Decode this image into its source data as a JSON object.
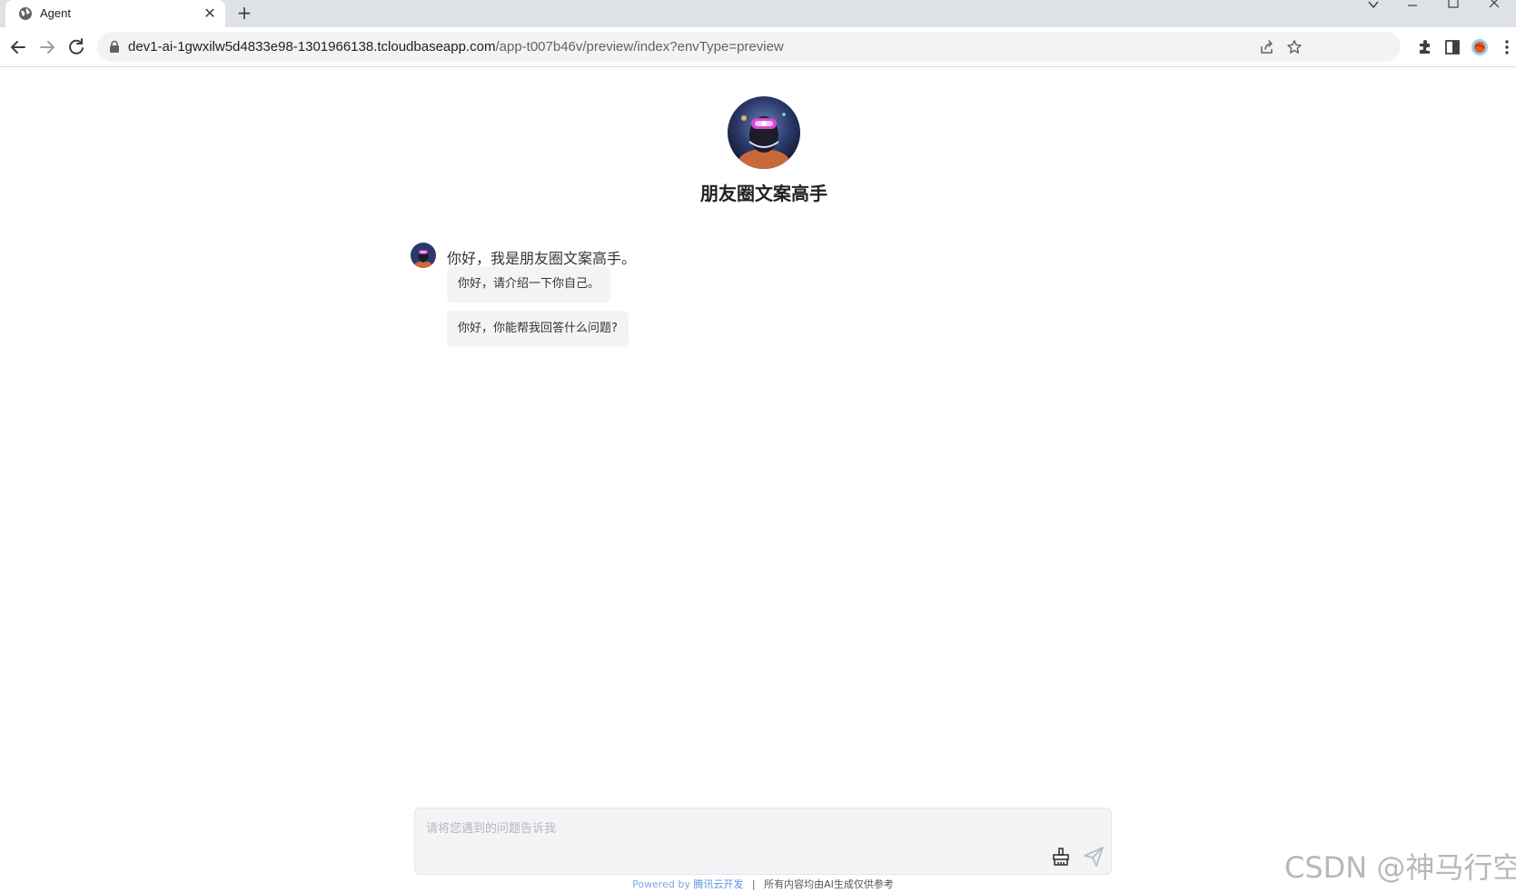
{
  "browser": {
    "tab_title": "Agent",
    "tab_close": "✕",
    "new_tab": "+",
    "url_host": "dev1-ai-1gwxilw5d4833e98-1301966138.tcloudbaseapp.com",
    "url_path": "/app-t007b46v/preview/index?envType=preview"
  },
  "agent": {
    "name": "朋友圈文案高手",
    "greeting": "你好，我是朋友圈文案高手。",
    "suggestions": [
      "你好，请介绍一下你自己。",
      "你好，你能帮我回答什么问题?"
    ]
  },
  "composer": {
    "placeholder": "请将您遇到的问题告诉我",
    "value": ""
  },
  "footer": {
    "powered_by": "Powered by",
    "brand": "腾讯云开发",
    "separator": "|",
    "disclaimer": "所有内容均由AI生成仅供参考"
  },
  "watermark": "CSDN @神马行空",
  "colors": {
    "accent": "#5b8fe3",
    "bubble_bg": "#f3f4f6",
    "chrome_bg": "#dee1e6"
  }
}
